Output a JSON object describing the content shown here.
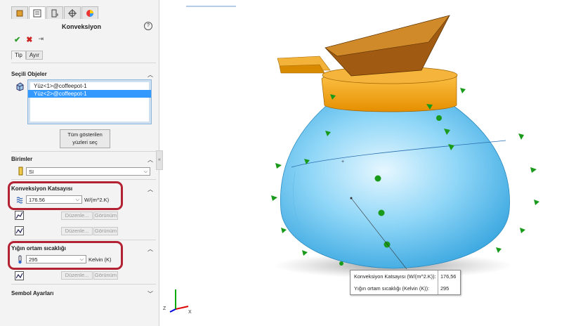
{
  "panel": {
    "title": "Konveksiyon",
    "help": "?",
    "tabs": [
      "Tip",
      "Ayır"
    ],
    "selected_entities": {
      "heading": "Seçili Objeler",
      "faces": [
        "Yüz<1>@coffeepot-1",
        "Yüz<2>@coffeepot-1"
      ],
      "show_all_button": "Tüm gösterilen\nyüzleri seç"
    },
    "units": {
      "heading": "Birimler",
      "value": "SI"
    },
    "convection_coeff": {
      "heading": "Konveksiyon Katsayısı",
      "value": "176.56",
      "unit": "W/(m^2.K)",
      "edit_label": "Düzenle...",
      "view_label": "Görünüm"
    },
    "bulk_temp": {
      "heading": "Yığın ortam sıcaklığı",
      "value": "295",
      "unit": "Kelvin (K)",
      "edit_label": "Düzenle...",
      "view_label": "Görünüm"
    },
    "symbol_settings": {
      "heading": "Sembol Ayarları"
    }
  },
  "tooltip": {
    "row1_label": "Konveksiyon Katsayısı (W/(m^2.K)):",
    "row1_value": "176,56",
    "row2_label": "Yığın ortam sıcaklığı (Kelvin (K)):",
    "row2_value": "295"
  },
  "triad": {
    "x": "X",
    "z": "Z"
  },
  "colors": {
    "highlight": "#b22233",
    "body": "#7fd0f2",
    "lid": "#f5a623",
    "arrow": "#1a9a1a",
    "selection": "#3399ff"
  }
}
